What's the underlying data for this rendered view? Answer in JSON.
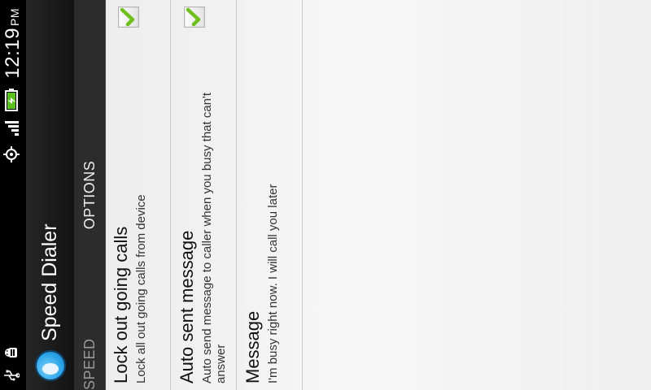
{
  "status_bar": {
    "time": "12:19",
    "ampm": "PM",
    "icons": [
      "usb-icon",
      "android-debug-icon",
      "gps-icon",
      "signal-icon",
      "battery-charging-icon"
    ]
  },
  "app": {
    "title": "Speed Dialer"
  },
  "tabs": [
    {
      "label": "SPEED",
      "selected": false
    },
    {
      "label": "OPTIONS",
      "selected": true
    }
  ],
  "options": [
    {
      "title": "Lock out going calls",
      "subtitle": "Lock all out going calls from device",
      "checked": true
    },
    {
      "title": "Auto sent message",
      "subtitle": "Auto send message to caller when you busy that can't answer",
      "checked": true
    },
    {
      "title": "Message",
      "subtitle": "I'm busy right now. I will call you later",
      "checked": false
    }
  ],
  "colors": {
    "accent_check": "#6fbf20",
    "action_bar": "#1a1a1a",
    "tab_bar": "#2c2c2c"
  }
}
